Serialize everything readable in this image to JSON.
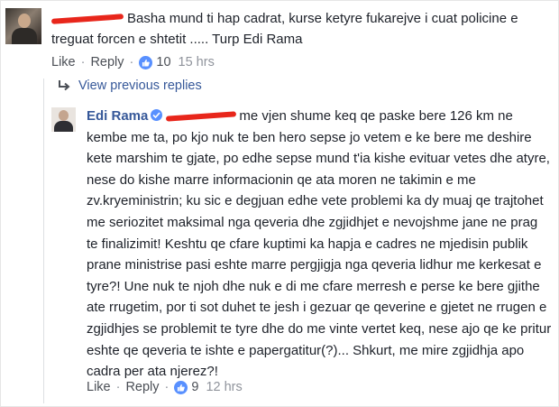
{
  "comment1": {
    "text": "Basha mund ti hap cadrat, kurse ketyre fukarejve i cuat policine e treguat forcen e shtetit ..... Turp Edi Rama",
    "actions": {
      "like": "Like",
      "reply": "Reply",
      "likes": "10",
      "time": "15 hrs"
    }
  },
  "view_previous": "View previous replies",
  "comment2": {
    "author": "Edi Rama",
    "text": "me vjen shume keq qe paske bere 126 km ne kembe me ta, po kjo nuk te ben hero sepse jo vetem e ke bere me deshire kete marshim te gjate, po edhe sepse mund t'ia kishe evituar vetes dhe atyre, nese do kishe marre informacionin qe ata moren ne takimin e me zv.kryeministrin; ku sic e degjuan edhe vete problemi ka dy muaj qe trajtohet me seriozitet maksimal nga qeveria dhe zgjidhjet e nevojshme jane ne prag te finalizimit! Keshtu qe cfare kuptimi ka hapja e cadres ne mjedisin publik prane ministrise pasi eshte marre pergjigja nga qeveria lidhur me kerkesat e tyre?! Une nuk te njoh dhe nuk e di me cfare merresh e perse ke bere gjithe ate rrugetim, por ti sot duhet te jesh i gezuar qe qeverine e gjetet ne rrugen e zgjidhjes se problemit te tyre dhe do me vinte vertet keq, nese ajo qe ke pritur eshte qe qeveria te ishte e papergatitur(?)... Shkurt, me mire zgjidhja apo cadra per ata njerez?!",
    "actions": {
      "like": "Like",
      "reply": "Reply",
      "likes": "9",
      "time": "12 hrs"
    }
  },
  "colors": {
    "link": "#365899",
    "meta": "#90949c",
    "like_badge": "#5890ff",
    "redaction": "#e8261b"
  }
}
